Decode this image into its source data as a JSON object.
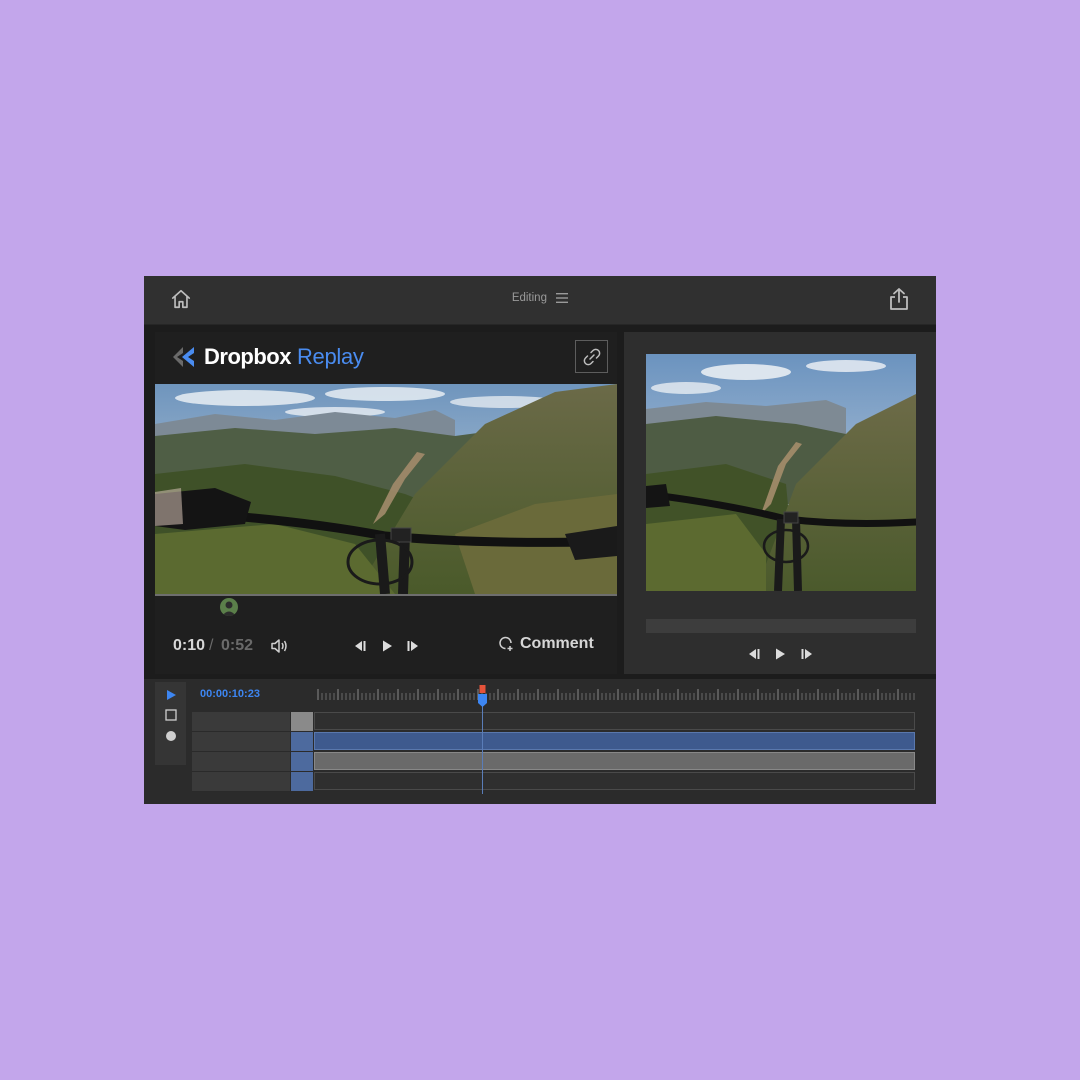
{
  "topbar": {
    "mode_label": "Editing",
    "icons": [
      "home-icon",
      "menu-icon",
      "share-icon"
    ]
  },
  "player": {
    "brand": {
      "name": "Dropbox",
      "product": "Replay"
    },
    "time_current": "0:10",
    "time_separator": "/",
    "time_total": "0:52",
    "comment_label": "Comment",
    "icons": [
      "dropbox-replay-logo-icon",
      "link-icon",
      "volume-icon",
      "step-back-icon",
      "play-icon",
      "step-forward-icon",
      "add-comment-icon"
    ]
  },
  "preview": {
    "icons": [
      "step-back-icon",
      "play-icon",
      "step-forward-icon"
    ]
  },
  "timeline": {
    "timecode": "00:00:10:23",
    "tools": [
      "play-tool-icon",
      "square-tool-icon",
      "circle-tool-icon"
    ],
    "track_count": 4
  },
  "colors": {
    "background": "#c3a6eb",
    "accent_blue": "#3d86f2",
    "playhead_red": "#e5533a",
    "track_blue": "#3e5a8e",
    "track_gray": "#6a6a6a"
  }
}
